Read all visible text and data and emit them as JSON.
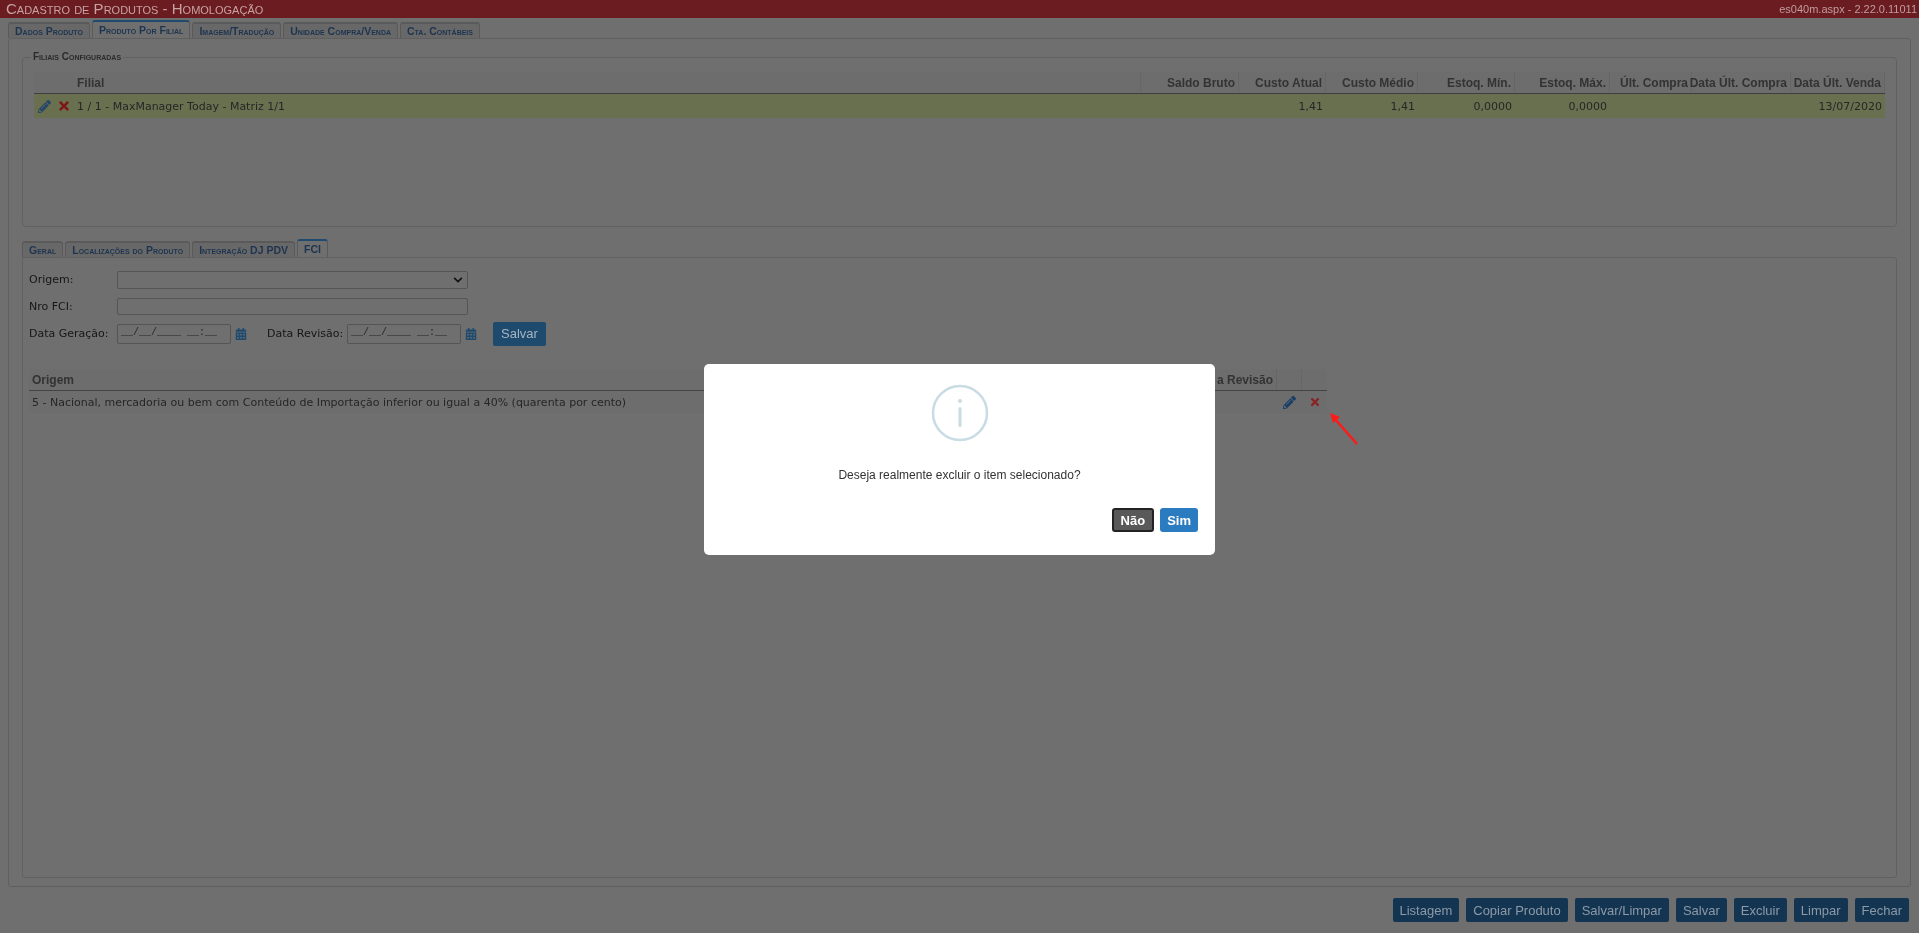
{
  "header": {
    "title": "Cadastro de Produtos  - Homologação",
    "version": "es040m.aspx - 2.22.0.11011"
  },
  "tabs": [
    {
      "label": "Dados Produto",
      "selected": false
    },
    {
      "label": "Produto Por Filial",
      "selected": true
    },
    {
      "label": "Imagem/Tradução",
      "selected": false
    },
    {
      "label": "Unidade Compra/Venda",
      "selected": false
    },
    {
      "label": "Cta. Contábeis",
      "selected": false
    }
  ],
  "branches": {
    "legend": "Filiais Configuradas",
    "columns": [
      "Filial",
      "Saldo Bruto",
      "Custo Atual",
      "Custo Médio",
      "Estoq. Mín.",
      "Estoq. Máx.",
      "Últ. Compra",
      "Data Últ. Compra",
      "Data Últ. Venda"
    ],
    "rows": [
      {
        "selected": true,
        "cells": [
          "1 / 1 - MaxManager Today - Matriz 1/1",
          null,
          "1,41",
          "1,41",
          "0,0000",
          "0,0000",
          null,
          null,
          "13/07/2020"
        ]
      }
    ]
  },
  "sub_tabs": [
    {
      "label": "Geral",
      "selected": false
    },
    {
      "label": "Localizações do Produto",
      "selected": false
    },
    {
      "label": "Integração DJ PDV",
      "selected": false
    },
    {
      "label": "FCI",
      "selected": true
    }
  ],
  "fci_form": {
    "fields": [
      {
        "kind": "select",
        "label": "Origem:"
      },
      {
        "kind": "text",
        "label": "Nro FCI:"
      }
    ],
    "dates": [
      {
        "label": "Data Geração:",
        "placeholder": "__/__/____ __:__"
      },
      {
        "label": "Data Revisão:",
        "placeholder": "__/__/____ __:__"
      }
    ],
    "save_button": "Salvar"
  },
  "fci_table": {
    "columns": [
      "Origem",
      "a Revisão"
    ],
    "rows": [
      {
        "origem": "5 - Nacional, mercadoria ou bem com Conteúdo de Importação inferior ou igual a 40% (quarenta por cento)"
      }
    ]
  },
  "dialog": {
    "message": "Deseja realmente excluir o item selecionado?",
    "buttons": [
      {
        "label": "Não",
        "kind": "secondary"
      },
      {
        "label": "Sim",
        "kind": "primary"
      }
    ]
  },
  "footer_buttons": [
    "Listagem",
    "Copiar Produto",
    "Salvar/Limpar",
    "Salvar",
    "Excluir",
    "Limpar",
    "Fechar"
  ]
}
